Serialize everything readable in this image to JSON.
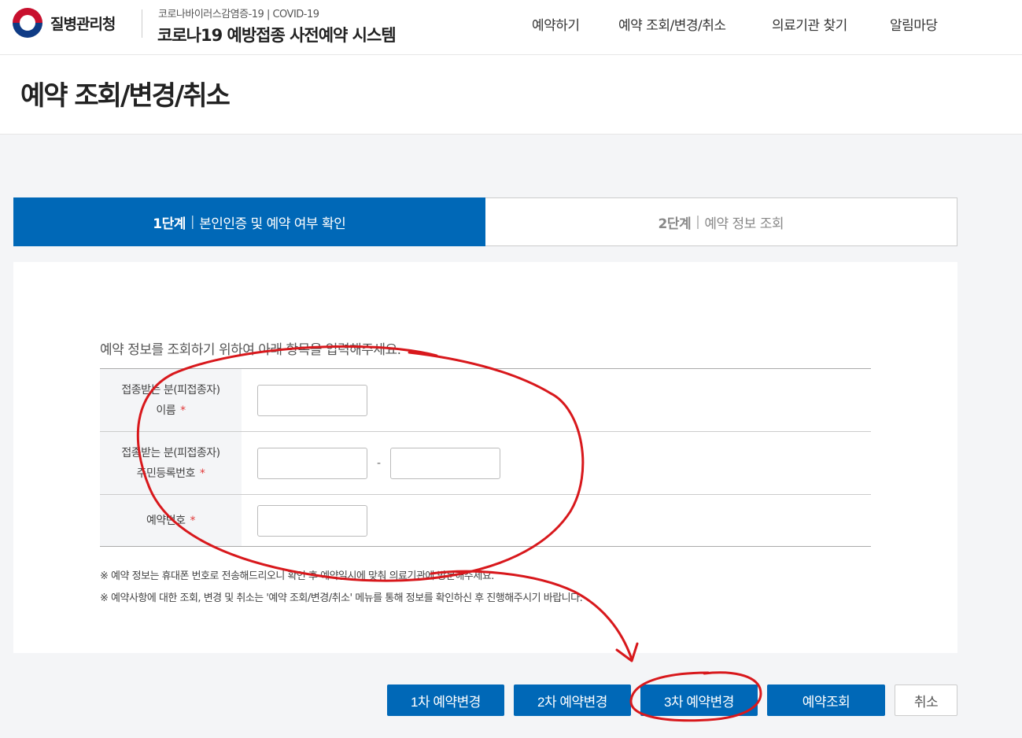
{
  "header": {
    "org_name": "질병관리청",
    "system_subtitle": "코로나바이러스감염증-19 | COVID-19",
    "system_title": "코로나19 예방접종 사전예약 시스템",
    "nav": [
      "예약하기",
      "예약 조회/변경/취소",
      "의료기관 찾기",
      "알림마당"
    ]
  },
  "page_title": "예약 조회/변경/취소",
  "steps": [
    {
      "num": "1단계",
      "label": "본인인증 및 예약 여부 확인",
      "active": true
    },
    {
      "num": "2단계",
      "label": "예약 정보 조회",
      "active": false
    }
  ],
  "form": {
    "intro": "예약 정보를 조회하기 위하여 아래 항목을 입력해주세요.",
    "rows": [
      {
        "label_line1": "접종받는 분(피접종자)",
        "label_line2": "이름",
        "required": "*"
      },
      {
        "label_line1": "접종받는 분(피접종자)",
        "label_line2": "주민등록번호",
        "required": "*"
      },
      {
        "label_line1": "예약번호",
        "required": "*"
      }
    ],
    "values": {
      "name": "",
      "rrn_front": "",
      "rrn_back": "",
      "reservation_no": ""
    },
    "rrn_separator": "-",
    "notes": [
      "※ 예약 정보는 휴대폰 번호로 전송해드리오니 확인 후 예약일시에 맞춰 의료기관에 방문해주세요.",
      "※ 예약사항에 대한 조회, 변경 및 취소는 '예약 조회/변경/취소' 메뉴를 통해 정보를 확인하신 후 진행해주시기 바랍니다."
    ]
  },
  "buttons": {
    "first_change": "1차 예약변경",
    "second_change": "2차 예약변경",
    "third_change": "3차 예약변경",
    "lookup": "예약조회",
    "cancel": "취소"
  },
  "colors": {
    "primary": "#0068b7",
    "annotation": "#d8181c",
    "required": "#e23b3b"
  },
  "icons": {
    "logo": "taegeuk-logo-icon"
  }
}
